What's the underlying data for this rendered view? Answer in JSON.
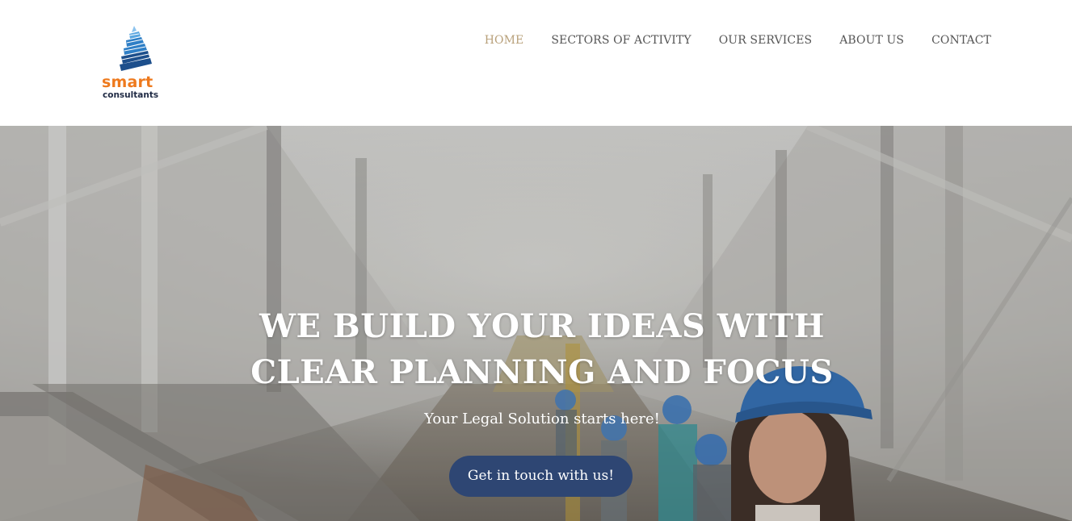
{
  "brand": {
    "name": "smart",
    "tagline": "consultants",
    "name_color": "#ee7a1e",
    "tagline_color": "#1f2a44",
    "mark_colors": [
      "#1d4f8c",
      "#2f7fc6",
      "#8cc3ee"
    ]
  },
  "nav": {
    "items": [
      {
        "label": "HOME",
        "active": true
      },
      {
        "label": "SECTORS OF ACTIVITY",
        "active": false
      },
      {
        "label": "OUR SERVICES",
        "active": false
      },
      {
        "label": "ABOUT US",
        "active": false
      },
      {
        "label": "CONTACT",
        "active": false
      }
    ],
    "active_color": "#b8a07a",
    "color": "#555555"
  },
  "hero": {
    "title_line1": "WE BUILD YOUR IDEAS WITH",
    "title_line2": "CLEAR PLANNING AND FOCUS",
    "subtitle": "Your Legal Solution starts here!",
    "cta_label": "Get in touch with us!",
    "cta_color": "#2e4673",
    "background_image": "construction-site-worker-photo"
  }
}
